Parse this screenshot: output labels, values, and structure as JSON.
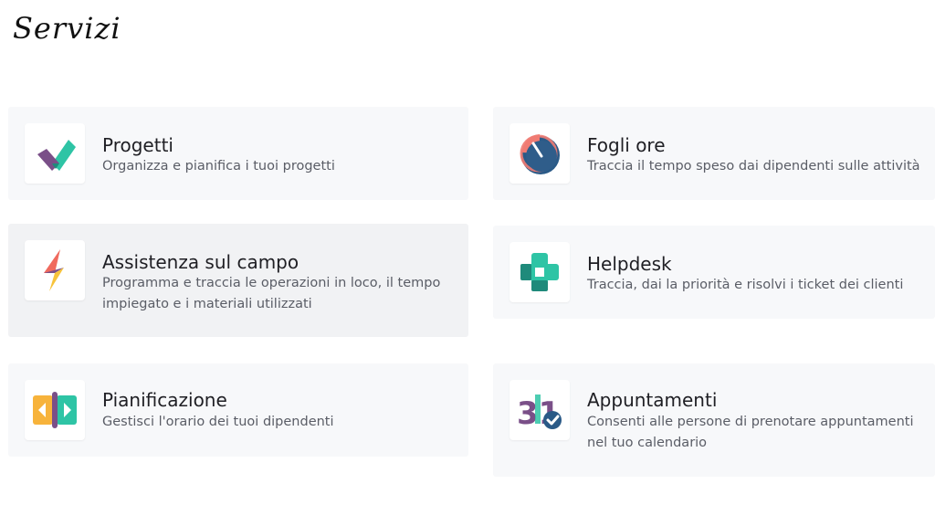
{
  "page": {
    "title": "Servizi"
  },
  "services": [
    {
      "title": "Progetti",
      "description": "Organizza e pianifica i tuoi progetti",
      "icon": "projects-icon"
    },
    {
      "title": "Fogli ore",
      "description": "Traccia il tempo speso dai dipendenti sulle attività",
      "icon": "timesheets-icon"
    },
    {
      "title": "Assistenza sul campo",
      "description": "Programma e traccia le operazioni in loco, il tempo impiegato e i materiali utilizzati",
      "icon": "field-service-icon"
    },
    {
      "title": "Helpdesk",
      "description": "Traccia, dai la priorità e risolvi i ticket dei clienti",
      "icon": "helpdesk-icon"
    },
    {
      "title": "Pianificazione",
      "description": "Gestisci l'orario dei tuoi dipendenti",
      "icon": "planning-icon"
    },
    {
      "title": "Appuntamenti",
      "description": "Consenti alle persone di prenotare appuntamenti nel tuo calendario",
      "icon": "appointments-icon",
      "icon_text": "31"
    }
  ],
  "colors": {
    "card_background": "#f7f8fa",
    "title_text": "#1f1f24",
    "description_text": "#5a5d66"
  }
}
